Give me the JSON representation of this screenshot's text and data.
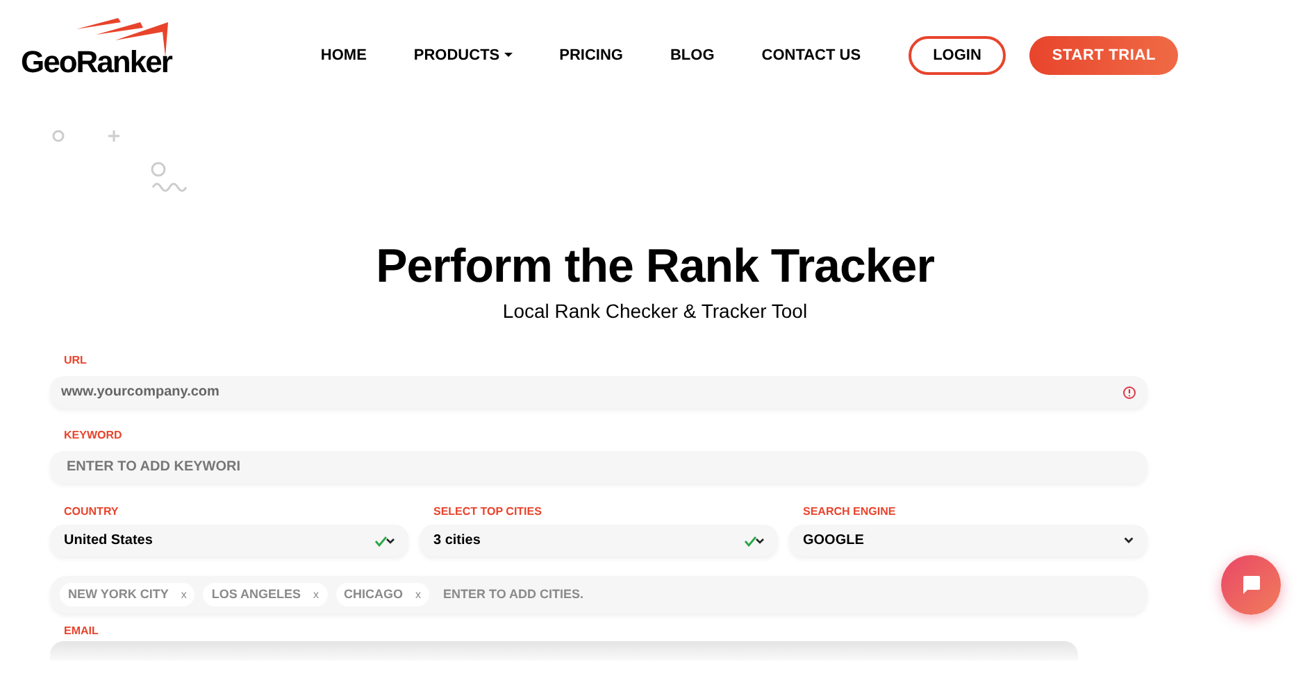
{
  "logo": {
    "text": "GeoRanker"
  },
  "nav": [
    {
      "label": "HOME",
      "kind": "link"
    },
    {
      "label": "PRODUCTS",
      "kind": "dropdown"
    },
    {
      "label": "PRICING",
      "kind": "link"
    },
    {
      "label": "BLOG",
      "kind": "link"
    },
    {
      "label": "CONTACT US",
      "kind": "link"
    },
    {
      "label": "LOGIN",
      "kind": "outline"
    },
    {
      "label": "START TRIAL",
      "kind": "solid"
    }
  ],
  "hero": {
    "title": "Perform the Rank Tracker",
    "subtitle": "Local Rank Checker & Tracker Tool"
  },
  "url": {
    "label": "URL",
    "value": "www.yourcompany.com",
    "invalid": true
  },
  "keyword": {
    "label": "KEYWORD",
    "placeholder": "ENTER TO ADD KEYWORI"
  },
  "selects": [
    {
      "label": "COUNTRY",
      "value": "United States",
      "valid": true
    },
    {
      "label": "SELECT TOP CITIES",
      "value": "3 cities",
      "valid": true
    },
    {
      "label": "SEARCH ENGINE",
      "value": "GOOGLE",
      "valid": false
    }
  ],
  "cities": {
    "tags": [
      {
        "label": "NEW YORK CITY",
        "remove": "x"
      },
      {
        "label": "LOS ANGELES",
        "remove": "x"
      },
      {
        "label": "CHICAGO",
        "remove": "x"
      }
    ],
    "placeholder": "ENTER TO ADD CITIES."
  },
  "email": {
    "label": "EMAIL"
  }
}
